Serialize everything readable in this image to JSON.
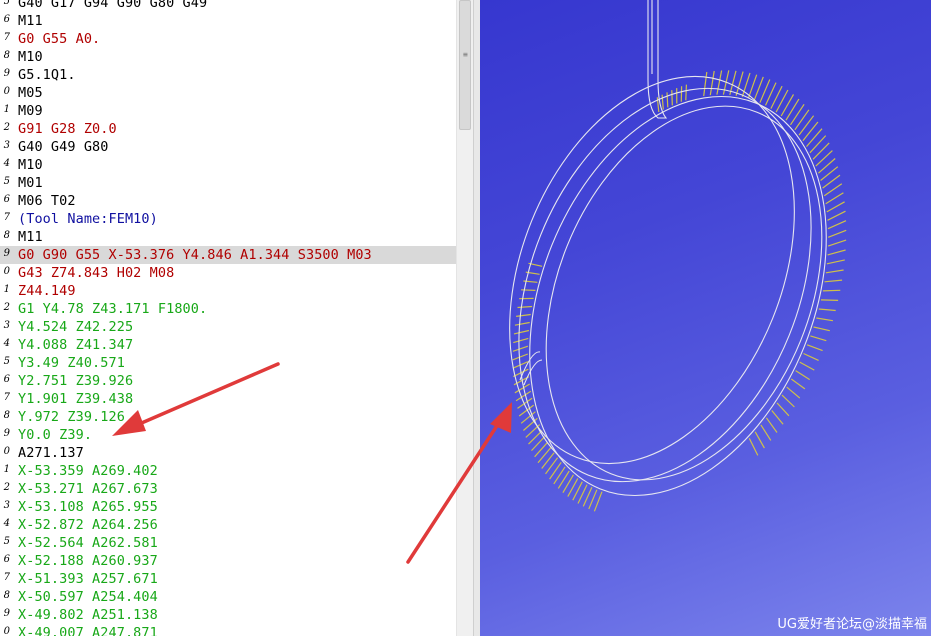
{
  "editor": {
    "lines": [
      {
        "num": "5",
        "text": "G40 G17 G94 G90 G80 G49",
        "color": "#000000"
      },
      {
        "num": "6",
        "text": "M11",
        "color": "#000000"
      },
      {
        "num": "7",
        "text": "G0 G55 A0.",
        "color": "#b00000"
      },
      {
        "num": "8",
        "text": "M10",
        "color": "#000000"
      },
      {
        "num": "9",
        "text": "G5.1Q1.",
        "color": "#000000"
      },
      {
        "num": "0",
        "text": "M05",
        "color": "#000000"
      },
      {
        "num": "1",
        "text": "M09",
        "color": "#000000"
      },
      {
        "num": "2",
        "text": "G91 G28 Z0.0",
        "color": "#b00000"
      },
      {
        "num": "3",
        "text": "G40 G49 G80",
        "color": "#000000"
      },
      {
        "num": "4",
        "text": "M10",
        "color": "#000000"
      },
      {
        "num": "5",
        "text": "M01",
        "color": "#000000"
      },
      {
        "num": "6",
        "text": "M06 T02",
        "color": "#000000"
      },
      {
        "num": "7",
        "text": "(Tool Name:FEM10)",
        "color": "#1010a0"
      },
      {
        "num": "8",
        "text": "M11",
        "color": "#000000"
      },
      {
        "num": "9",
        "text": "G0 G90 G55 X-53.376 Y4.846 A1.344 S3500 M03",
        "color": "#b00000",
        "highlight": true
      },
      {
        "num": "0",
        "text": "G43 Z74.843 H02 M08",
        "color": "#b00000"
      },
      {
        "num": "1",
        "text": "Z44.149",
        "color": "#b00000"
      },
      {
        "num": "2",
        "text": "G1 Y4.78 Z43.171 F1800.",
        "color": "#18a818"
      },
      {
        "num": "3",
        "text": "Y4.524 Z42.225",
        "color": "#18a818"
      },
      {
        "num": "4",
        "text": "Y4.088 Z41.347",
        "color": "#18a818"
      },
      {
        "num": "5",
        "text": "Y3.49 Z40.571",
        "color": "#18a818"
      },
      {
        "num": "6",
        "text": "Y2.751 Z39.926",
        "color": "#18a818"
      },
      {
        "num": "7",
        "text": "Y1.901 Z39.438",
        "color": "#18a818"
      },
      {
        "num": "8",
        "text": "Y.972 Z39.126",
        "color": "#18a818"
      },
      {
        "num": "9",
        "text": "Y0.0 Z39.",
        "color": "#18a818"
      },
      {
        "num": "0",
        "text": "A271.137",
        "color": "#000000"
      },
      {
        "num": "1",
        "text": "X-53.359 A269.402",
        "color": "#18a818"
      },
      {
        "num": "2",
        "text": "X-53.271 A267.673",
        "color": "#18a818"
      },
      {
        "num": "3",
        "text": "X-53.108 A265.955",
        "color": "#18a818"
      },
      {
        "num": "4",
        "text": "X-52.872 A264.256",
        "color": "#18a818"
      },
      {
        "num": "5",
        "text": "X-52.564 A262.581",
        "color": "#18a818"
      },
      {
        "num": "6",
        "text": "X-52.188 A260.937",
        "color": "#18a818"
      },
      {
        "num": "7",
        "text": "X-51.393 A257.671",
        "color": "#18a818"
      },
      {
        "num": "8",
        "text": "X-50.597 A254.404",
        "color": "#18a818"
      },
      {
        "num": "9",
        "text": "X-49.802 A251.138",
        "color": "#18a818"
      },
      {
        "num": "0",
        "text": "X-49.007 A247.871",
        "color": "#18a818"
      }
    ]
  },
  "viewport": {
    "watermark": "UG爱好者论坛@淡描幸福"
  },
  "colors": {
    "arrow": "#e03a3a",
    "wireframe": "#e6e6f0",
    "toolpath": "#cfc04a"
  },
  "icons": {
    "scroll_grip": "grip-lines-icon"
  }
}
